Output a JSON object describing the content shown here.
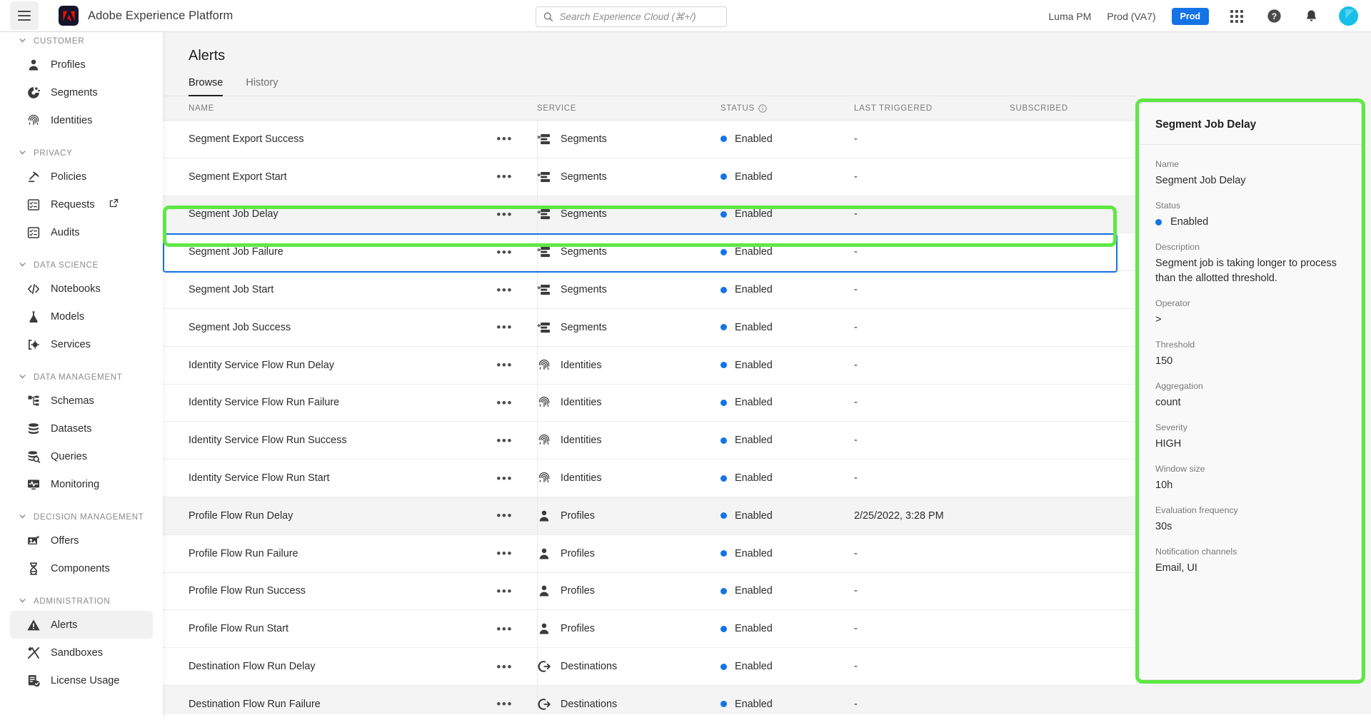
{
  "header": {
    "menu_icon": "hamburger-icon",
    "brand_logo": "adobe-logo",
    "brand_title": "Adobe Experience Platform",
    "search": {
      "icon": "search-icon",
      "placeholder": "Search Experience Cloud (⌘+/)",
      "value": ""
    },
    "org_name": "Luma PM",
    "sandbox_name": "Prod (VA7)",
    "env_badge": "Prod",
    "apps_icon": "grid-apps-icon",
    "help_icon": "help-circle-icon",
    "notifications_icon": "bell-icon",
    "avatar": "user-avatar"
  },
  "sidebar": {
    "sections": [
      {
        "label": "CUSTOMER",
        "items": [
          {
            "label": "Profiles",
            "icon": "person-icon",
            "active": false,
            "external": false
          },
          {
            "label": "Segments",
            "icon": "segment-donut-icon",
            "active": false,
            "external": false
          },
          {
            "label": "Identities",
            "icon": "fingerprint-icon",
            "active": false,
            "external": false
          }
        ]
      },
      {
        "label": "PRIVACY",
        "items": [
          {
            "label": "Policies",
            "icon": "gavel-icon",
            "active": false,
            "external": false
          },
          {
            "label": "Requests",
            "icon": "checklist-icon",
            "active": false,
            "external": true
          },
          {
            "label": "Audits",
            "icon": "checklist-icon",
            "active": false,
            "external": false
          }
        ]
      },
      {
        "label": "DATA SCIENCE",
        "items": [
          {
            "label": "Notebooks",
            "icon": "code-brackets-icon",
            "active": false,
            "external": false
          },
          {
            "label": "Models",
            "icon": "flask-icon",
            "active": false,
            "external": false
          },
          {
            "label": "Services",
            "icon": "services-gear-icon",
            "active": false,
            "external": false
          }
        ]
      },
      {
        "label": "DATA MANAGEMENT",
        "items": [
          {
            "label": "Schemas",
            "icon": "schema-tree-icon",
            "active": false,
            "external": false
          },
          {
            "label": "Datasets",
            "icon": "database-icon",
            "active": false,
            "external": false
          },
          {
            "label": "Queries",
            "icon": "database-search-icon",
            "active": false,
            "external": false
          },
          {
            "label": "Monitoring",
            "icon": "monitor-pulse-icon",
            "active": false,
            "external": false
          }
        ]
      },
      {
        "label": "DECISION MANAGEMENT",
        "items": [
          {
            "label": "Offers",
            "icon": "offer-card-icon",
            "active": false,
            "external": false
          },
          {
            "label": "Components",
            "icon": "helix-icon",
            "active": false,
            "external": false
          }
        ]
      },
      {
        "label": "ADMINISTRATION",
        "items": [
          {
            "label": "Alerts",
            "icon": "warning-triangle-icon",
            "active": true,
            "external": false
          },
          {
            "label": "Sandboxes",
            "icon": "tools-icon",
            "active": false,
            "external": false
          },
          {
            "label": "License Usage",
            "icon": "license-check-icon",
            "active": false,
            "external": false
          }
        ]
      }
    ]
  },
  "main": {
    "title": "Alerts",
    "tabs": [
      {
        "label": "Browse",
        "active": true
      },
      {
        "label": "History",
        "active": false
      }
    ],
    "table": {
      "columns": [
        "NAME",
        "SERVICE",
        "STATUS",
        "LAST TRIGGERED",
        "SUBSCRIBED"
      ],
      "status_info_icon": "info-circle-icon",
      "row_menu_icon": "more-horizontal-icon",
      "rows": [
        {
          "name": "Segment Export Success",
          "service": "Segments",
          "service_icon": "segment-stack-icon",
          "status": "Enabled",
          "last_triggered": "-",
          "subscribed": "",
          "state": "normal"
        },
        {
          "name": "Segment Export Start",
          "service": "Segments",
          "service_icon": "segment-stack-icon",
          "status": "Enabled",
          "last_triggered": "-",
          "subscribed": "",
          "state": "normal"
        },
        {
          "name": "Segment Job Delay",
          "service": "Segments",
          "service_icon": "segment-stack-icon",
          "status": "Enabled",
          "last_triggered": "-",
          "subscribed": "",
          "state": "selected"
        },
        {
          "name": "Segment Job Failure",
          "service": "Segments",
          "service_icon": "segment-stack-icon",
          "status": "Enabled",
          "last_triggered": "-",
          "subscribed": "",
          "state": "normal"
        },
        {
          "name": "Segment Job Start",
          "service": "Segments",
          "service_icon": "segment-stack-icon",
          "status": "Enabled",
          "last_triggered": "-",
          "subscribed": "",
          "state": "normal"
        },
        {
          "name": "Segment Job Success",
          "service": "Segments",
          "service_icon": "segment-stack-icon",
          "status": "Enabled",
          "last_triggered": "-",
          "subscribed": "",
          "state": "normal"
        },
        {
          "name": "Identity Service Flow Run Delay",
          "service": "Identities",
          "service_icon": "fingerprint-icon",
          "status": "Enabled",
          "last_triggered": "-",
          "subscribed": "",
          "state": "normal"
        },
        {
          "name": "Identity Service Flow Run Failure",
          "service": "Identities",
          "service_icon": "fingerprint-icon",
          "status": "Enabled",
          "last_triggered": "-",
          "subscribed": "",
          "state": "normal"
        },
        {
          "name": "Identity Service Flow Run Success",
          "service": "Identities",
          "service_icon": "fingerprint-icon",
          "status": "Enabled",
          "last_triggered": "-",
          "subscribed": "",
          "state": "normal"
        },
        {
          "name": "Identity Service Flow Run Start",
          "service": "Identities",
          "service_icon": "fingerprint-icon",
          "status": "Enabled",
          "last_triggered": "-",
          "subscribed": "",
          "state": "normal"
        },
        {
          "name": "Profile Flow Run Delay",
          "service": "Profiles",
          "service_icon": "person-icon",
          "status": "Enabled",
          "last_triggered": "2/25/2022, 3:28 PM",
          "subscribed": "",
          "state": "hover"
        },
        {
          "name": "Profile Flow Run Failure",
          "service": "Profiles",
          "service_icon": "person-icon",
          "status": "Enabled",
          "last_triggered": "-",
          "subscribed": "",
          "state": "normal"
        },
        {
          "name": "Profile Flow Run Success",
          "service": "Profiles",
          "service_icon": "person-icon",
          "status": "Enabled",
          "last_triggered": "-",
          "subscribed": "",
          "state": "normal"
        },
        {
          "name": "Profile Flow Run Start",
          "service": "Profiles",
          "service_icon": "person-icon",
          "status": "Enabled",
          "last_triggered": "-",
          "subscribed": "",
          "state": "normal"
        },
        {
          "name": "Destination Flow Run Delay",
          "service": "Destinations",
          "service_icon": "destination-arrow-icon",
          "status": "Enabled",
          "last_triggered": "-",
          "subscribed": "",
          "state": "normal"
        },
        {
          "name": "Destination Flow Run Failure",
          "service": "Destinations",
          "service_icon": "destination-arrow-icon",
          "status": "Enabled",
          "last_triggered": "-",
          "subscribed": "",
          "state": "hover"
        }
      ]
    }
  },
  "detail_panel": {
    "title": "Segment Job Delay",
    "fields": [
      {
        "label": "Name",
        "value": "Segment Job Delay"
      },
      {
        "label": "Status",
        "value": "Enabled",
        "type": "status"
      },
      {
        "label": "Description",
        "value": "Segment job is taking longer to process than the allotted threshold."
      },
      {
        "label": "Operator",
        "value": ">"
      },
      {
        "label": "Threshold",
        "value": "150"
      },
      {
        "label": "Aggregation",
        "value": "count"
      },
      {
        "label": "Severity",
        "value": "HIGH"
      },
      {
        "label": "Window size",
        "value": "10h"
      },
      {
        "label": "Evaluation frequency",
        "value": "30s"
      },
      {
        "label": "Notification channels",
        "value": "Email, UI"
      }
    ]
  },
  "annotations": {
    "highlight_color": "#5FE845",
    "selection_color": "#1473e6",
    "targets": [
      "selected-table-row",
      "detail-panel"
    ]
  }
}
